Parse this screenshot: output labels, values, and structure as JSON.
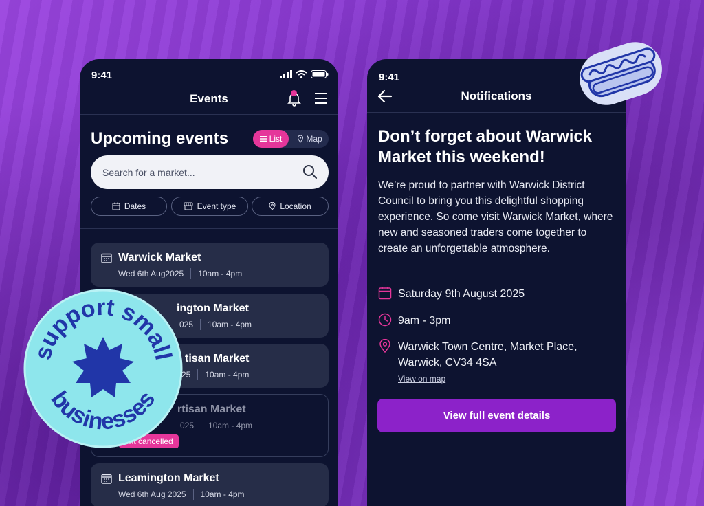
{
  "colors": {
    "background": "#8e3ed6",
    "phone": "#0d1330",
    "card": "#262d48",
    "accent_pink": "#e5369a",
    "accent_purple": "#8c22c9",
    "sticker_teal": "#8ee6ec",
    "sticker_blue": "#2136a8"
  },
  "events_screen": {
    "status_time": "9:41",
    "header_title": "Events",
    "heading": "Upcoming events",
    "view_toggle": {
      "list_label": "List",
      "map_label": "Map",
      "selected": "List"
    },
    "search": {
      "placeholder": "Search for a market...",
      "value": ""
    },
    "filters": [
      {
        "label": "Dates",
        "icon": "calendar-icon"
      },
      {
        "label": "Event type",
        "icon": "market-stall-icon"
      },
      {
        "label": "Location",
        "icon": "location-pin-icon"
      }
    ],
    "events": [
      {
        "title": "Warwick Market",
        "date": "Wed 6th Aug2025",
        "time": "10am - 4pm",
        "status": ""
      },
      {
        "title": "ington Market",
        "date": "025",
        "time": "10am - 4pm",
        "status": ""
      },
      {
        "title": "tisan Market",
        "date": "25",
        "time": "10am - 4pm",
        "status": ""
      },
      {
        "title": "rtisan Market",
        "date": "025",
        "time": "10am - 4pm",
        "status": "ent cancelled"
      },
      {
        "title": "Leamington Market",
        "date": "Wed 6th Aug 2025",
        "time": "10am - 4pm",
        "status": ""
      }
    ]
  },
  "notification_screen": {
    "status_time": "9:41",
    "header_title": "Notifications",
    "heading": "Don’t forget about Warwick Market this weekend!",
    "body": "We’re proud to partner with Warwick District Council to bring you this delightful shopping experience. So come visit Warwick Market, where new and seasoned traders come together to create an unforgettable atmosphere.",
    "date": "Saturday 9th August 2025",
    "time": "9am - 3pm",
    "location_line1": "Warwick Town Centre, Market Place,",
    "location_line2": "Warwick, CV34 4SA",
    "map_link": "View on map",
    "cta_label": "View full event details"
  },
  "sticker_badge": {
    "text_top": "support small",
    "text_bottom": "businesses"
  },
  "sticker_hotdog": {
    "icon": "hotdog-icon"
  }
}
